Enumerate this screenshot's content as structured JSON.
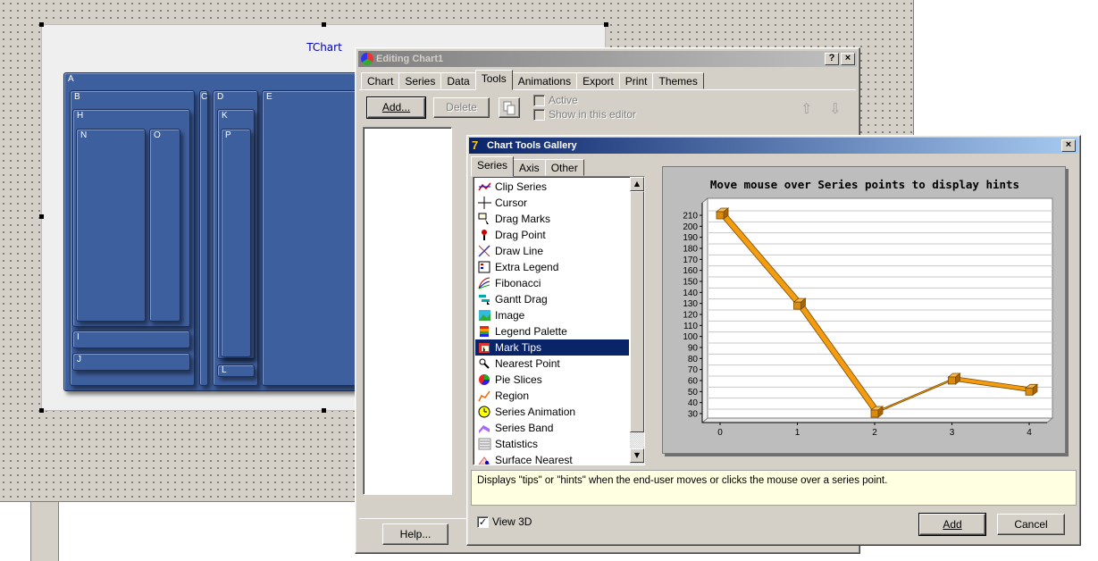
{
  "designer": {
    "chart_title": "TChart",
    "panel_labels": [
      "A",
      "B",
      "C",
      "D",
      "E",
      "H",
      "K",
      "N",
      "O",
      "P",
      "I",
      "J",
      "L"
    ]
  },
  "editor": {
    "title": "Editing Chart1",
    "help_button": "?",
    "close_button": "×",
    "tabs": [
      "Chart",
      "Series",
      "Data",
      "Tools",
      "Animations",
      "Export",
      "Print",
      "Themes"
    ],
    "selected_tab": "Tools",
    "add_button": "Add...",
    "delete_button": "Delete",
    "active_label": "Active",
    "show_in_editor_label": "Show in this editor",
    "help_bottom_button": "Help..."
  },
  "gallery": {
    "title": "Chart Tools Gallery",
    "close_button": "×",
    "tabs": [
      "Series",
      "Axis",
      "Other"
    ],
    "selected_tab": "Series",
    "items": [
      {
        "label": "Clip Series",
        "icon": "clip-series-icon"
      },
      {
        "label": "Cursor",
        "icon": "cursor-icon"
      },
      {
        "label": "Drag Marks",
        "icon": "drag-marks-icon"
      },
      {
        "label": "Drag Point",
        "icon": "drag-point-icon"
      },
      {
        "label": "Draw Line",
        "icon": "draw-line-icon"
      },
      {
        "label": "Extra Legend",
        "icon": "extra-legend-icon"
      },
      {
        "label": "Fibonacci",
        "icon": "fibonacci-icon"
      },
      {
        "label": "Gantt Drag",
        "icon": "gantt-drag-icon"
      },
      {
        "label": "Image",
        "icon": "image-icon"
      },
      {
        "label": "Legend Palette",
        "icon": "legend-palette-icon"
      },
      {
        "label": "Mark Tips",
        "icon": "mark-tips-icon"
      },
      {
        "label": "Nearest Point",
        "icon": "nearest-point-icon"
      },
      {
        "label": "Pie Slices",
        "icon": "pie-slices-icon"
      },
      {
        "label": "Region",
        "icon": "region-icon"
      },
      {
        "label": "Series Animation",
        "icon": "series-animation-icon"
      },
      {
        "label": "Series Band",
        "icon": "series-band-icon"
      },
      {
        "label": "Statistics",
        "icon": "statistics-icon"
      },
      {
        "label": "Surface Nearest",
        "icon": "surface-nearest-icon"
      }
    ],
    "selected_item": "Mark Tips",
    "hint_text": "Displays \"tips\" or \"hints\" when the end-user moves or clicks the mouse over a series point.",
    "view3d_label": "View 3D",
    "view3d_checked": true,
    "add_button": "Add",
    "cancel_button": "Cancel"
  },
  "chart_data": {
    "type": "line",
    "title": "Move mouse over Series points to display hints",
    "x": [
      0,
      1,
      2,
      3,
      4
    ],
    "values": [
      210,
      128,
      30,
      60,
      50
    ],
    "xlim": [
      0,
      4
    ],
    "ylim": [
      30,
      210
    ],
    "yticks": [
      30,
      40,
      50,
      60,
      70,
      80,
      90,
      100,
      110,
      120,
      130,
      140,
      150,
      160,
      170,
      180,
      190,
      200,
      210
    ],
    "xticks": [
      0,
      1,
      2,
      3,
      4
    ],
    "grid": true,
    "view3d": true,
    "colors": {
      "line": "#f39c12",
      "point": "#d98b10",
      "outline": "#7a4b00"
    }
  }
}
